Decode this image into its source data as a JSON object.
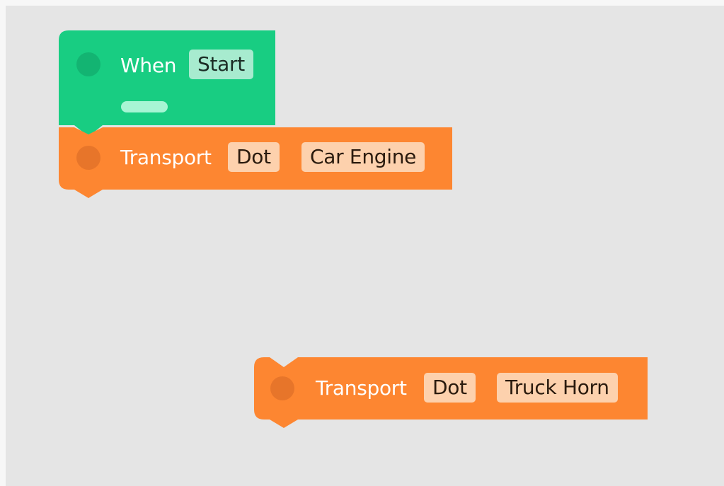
{
  "colors": {
    "workspace_bg": "#e5e5e5",
    "event_block": "#18cd82",
    "event_dot": "#13b472",
    "transport_block": "#fd8631",
    "transport_dot": "#e7752a"
  },
  "blocks": {
    "when": {
      "label": "When",
      "trigger": "Start"
    },
    "transport_1": {
      "label": "Transport",
      "target": "Dot",
      "sound": "Car Engine"
    },
    "transport_2": {
      "label": "Transport",
      "target": "Dot",
      "sound": "Truck Horn"
    }
  }
}
